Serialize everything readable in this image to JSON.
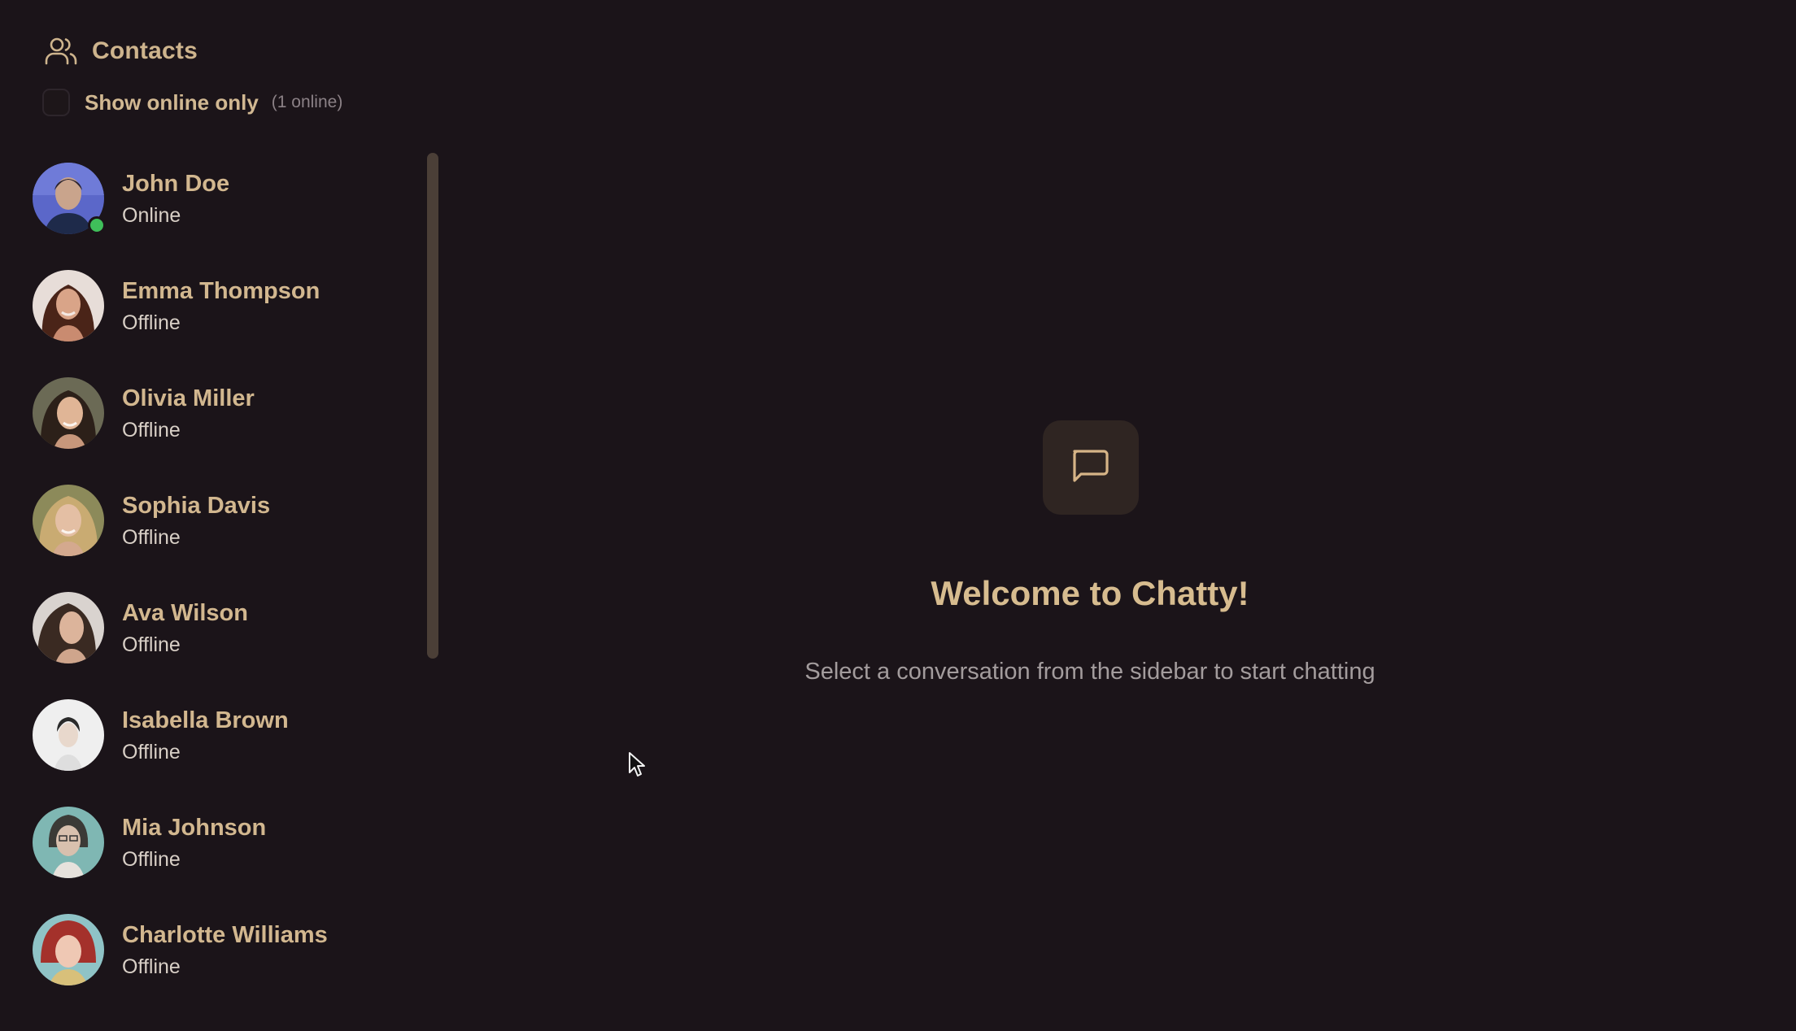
{
  "sidebar": {
    "title": "Contacts",
    "title_icon": "users-icon",
    "filter": {
      "label": "Show online only",
      "checked": false,
      "online_count": "(1 online)"
    },
    "contacts": [
      {
        "name": "John Doe",
        "status": "Online",
        "online": true
      },
      {
        "name": "Emma Thompson",
        "status": "Offline",
        "online": false
      },
      {
        "name": "Olivia Miller",
        "status": "Offline",
        "online": false
      },
      {
        "name": "Sophia Davis",
        "status": "Offline",
        "online": false
      },
      {
        "name": "Ava Wilson",
        "status": "Offline",
        "online": false
      },
      {
        "name": "Isabella Brown",
        "status": "Offline",
        "online": false
      },
      {
        "name": "Mia Johnson",
        "status": "Offline",
        "online": false
      },
      {
        "name": "Charlotte Williams",
        "status": "Offline",
        "online": false
      }
    ]
  },
  "main": {
    "icon": "message-square-icon",
    "title": "Welcome to Chatty!",
    "subtitle": "Select a conversation from the sidebar to start chatting"
  },
  "colors": {
    "background": "#1b1419",
    "accent": "#d2b78f",
    "online": "#3fbf5a",
    "muted_text": "#a39c9d"
  }
}
